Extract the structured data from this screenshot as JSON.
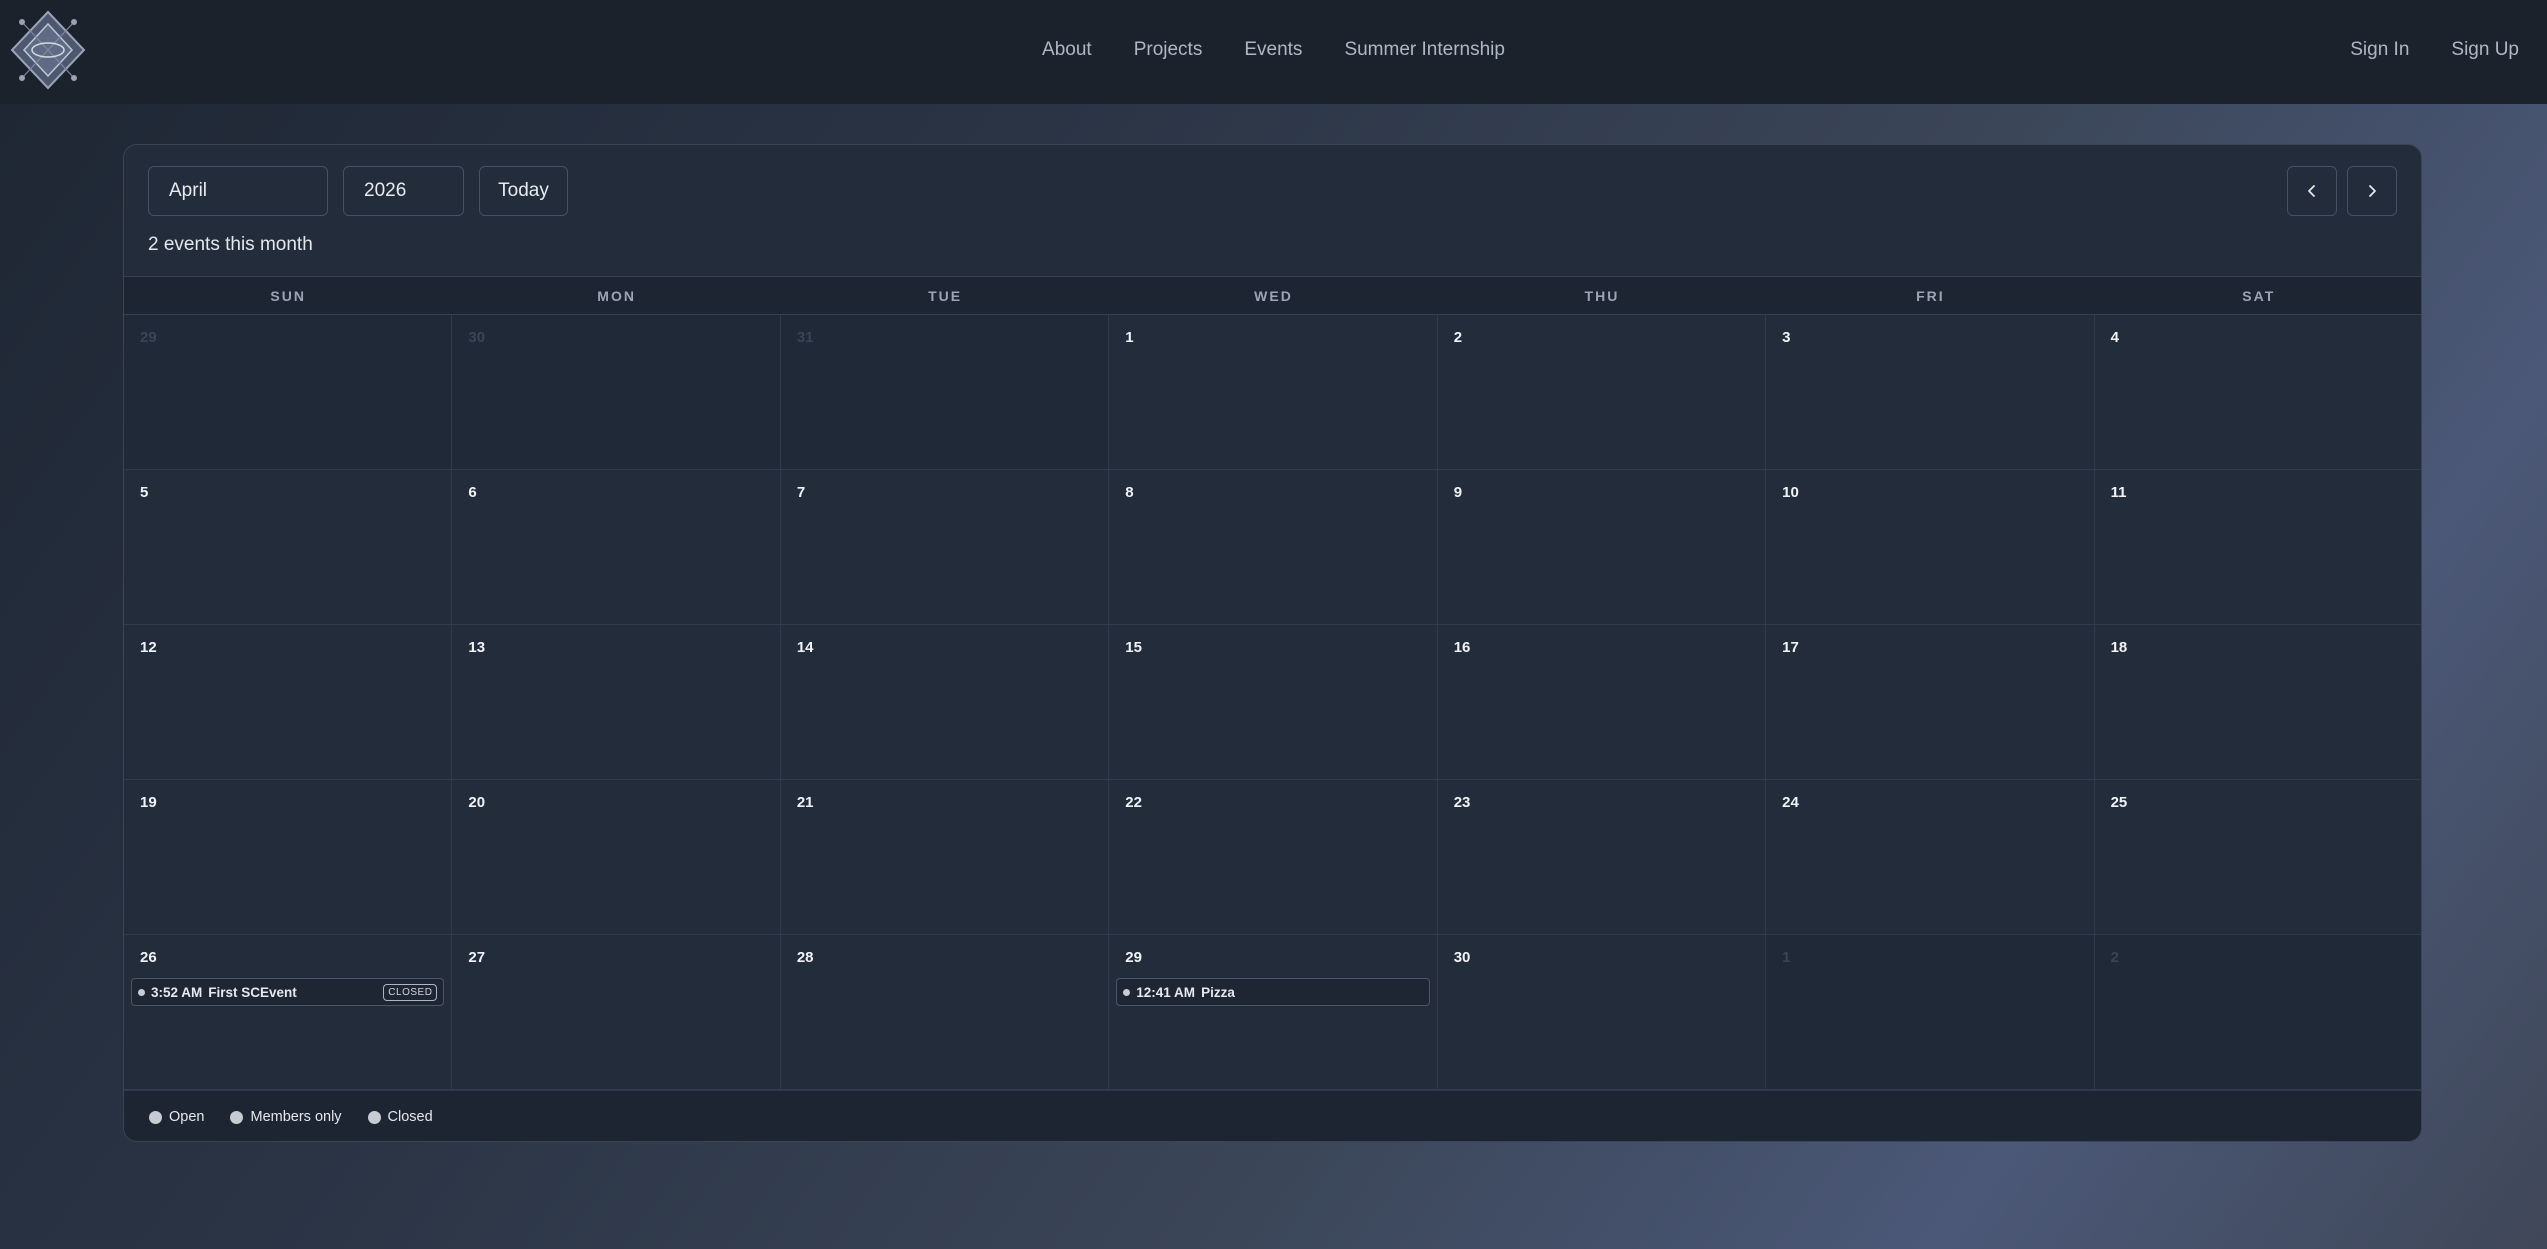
{
  "nav": {
    "links": [
      "About",
      "Projects",
      "Events",
      "Summer Internship"
    ],
    "sign_in": "Sign In",
    "sign_up": "Sign Up"
  },
  "calendar": {
    "month": "April",
    "year": "2026",
    "today_label": "Today",
    "summary": "2 events this month",
    "weekdays": [
      "SUN",
      "MON",
      "TUE",
      "WED",
      "THU",
      "FRI",
      "SAT"
    ],
    "days": [
      "29",
      "30",
      "31",
      "1",
      "2",
      "3",
      "4",
      "5",
      "6",
      "7",
      "8",
      "9",
      "10",
      "11",
      "12",
      "13",
      "14",
      "15",
      "16",
      "17",
      "18",
      "19",
      "20",
      "21",
      "22",
      "23",
      "24",
      "25",
      "26",
      "27",
      "28",
      "29",
      "30",
      "1",
      "2"
    ],
    "other_month": [
      0,
      1,
      2,
      33,
      34
    ],
    "events": [
      {
        "cell": 28,
        "time": "3:52 AM",
        "title": "First SCEvent",
        "badge": "CLOSED"
      },
      {
        "cell": 31,
        "time": "12:41 AM",
        "title": "Pizza",
        "badge": ""
      }
    ],
    "legend": [
      "Open",
      "Members only",
      "Closed"
    ]
  },
  "colors": {
    "accent_dot": "#c7ccd4",
    "card_bg": "#222c3b"
  }
}
